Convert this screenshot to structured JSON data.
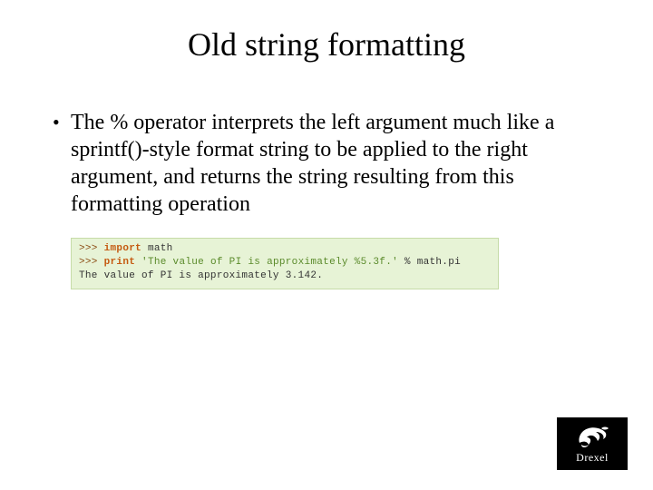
{
  "title": "Old string formatting",
  "bullet": "The % operator interprets the left argument much like a sprintf()-style format string to be applied to the right argument, and returns the string resulting from this formatting operation",
  "code": {
    "prompt": ">>>",
    "kw_import": "import",
    "mod": "math",
    "kw_print": "print",
    "str_literal": "'The value of PI is approximately %5.3f.'",
    "expr_tail": " % math.pi",
    "output": "The value of PI is approximately 3.142."
  },
  "logo": {
    "name": "Drexel"
  }
}
